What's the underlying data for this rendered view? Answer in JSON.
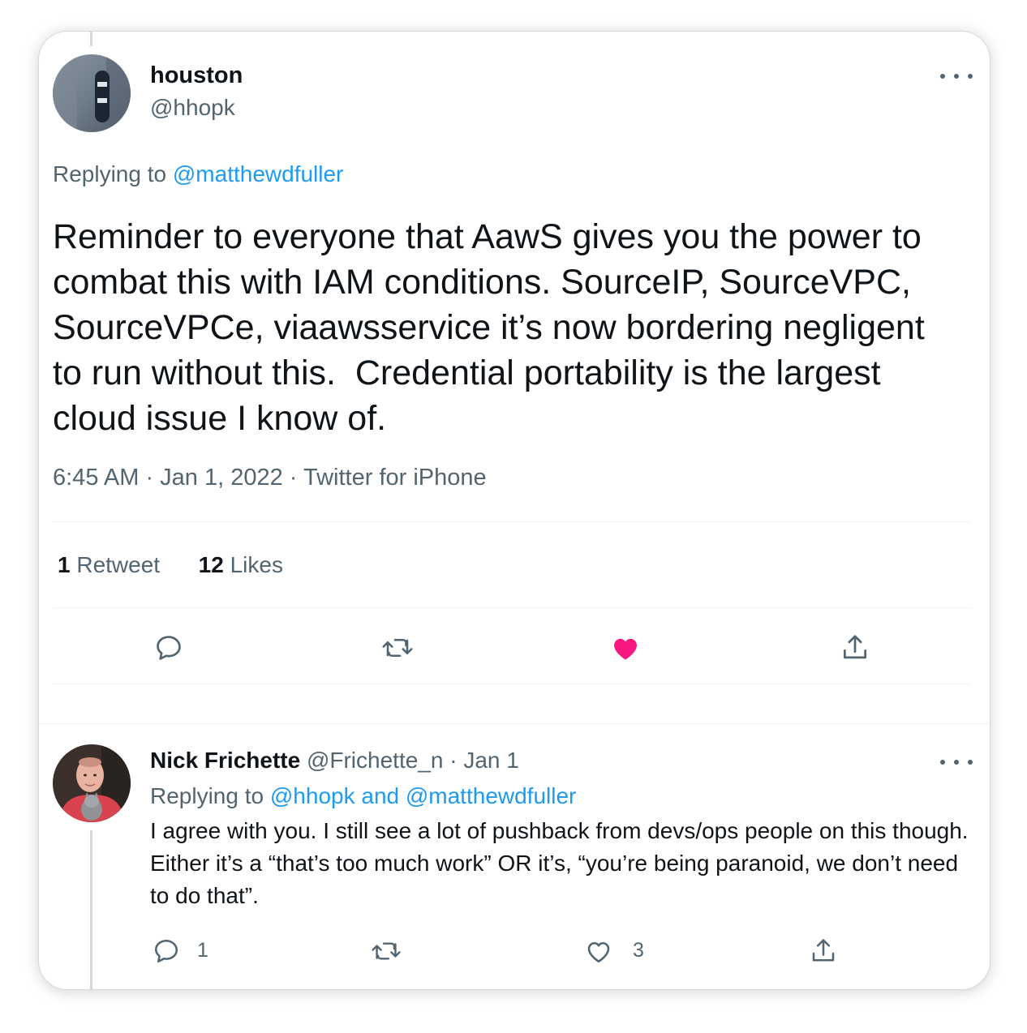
{
  "main_tweet": {
    "display_name": "houston",
    "handle": "@hhopk",
    "replying_prefix": "Replying to",
    "replying_to": "@matthewdfuller",
    "text": "Reminder to everyone that AawS gives you the power to combat this with IAM conditions. SourceIP, SourceVPC, SourceVPCe, viaawsservice it’s now bordering negligent to run without this.  Credential portability is the largest cloud issue I know of.",
    "meta": "6:45 AM · Jan 1, 2022 · Twitter for iPhone",
    "retweet_count": "1",
    "retweet_label": "Retweet",
    "like_count": "12",
    "like_label": "Likes",
    "actions": [
      "reply-icon",
      "retweet-icon",
      "like-filled-icon",
      "share-icon"
    ]
  },
  "reply_tweet": {
    "display_name": "Nick Frichette",
    "handle_date": "@Frichette_n · Jan 1",
    "replying_prefix": "Replying to",
    "replying_to": "@hhopk and @matthewdfuller",
    "text": "I agree with you. I still see a lot of pushback from devs/ops people on this though. Either it’s a “that’s too much work” OR it’s, “you’re being paranoid, we don’t need to do that”.",
    "reply_count": "1",
    "like_count": "3",
    "actions": [
      "reply-icon",
      "retweet-icon",
      "like-icon",
      "share-icon"
    ]
  },
  "colors": {
    "accent": "#1d9bf0",
    "like": "#f91880",
    "muted": "#536471",
    "text": "#0f1419"
  }
}
